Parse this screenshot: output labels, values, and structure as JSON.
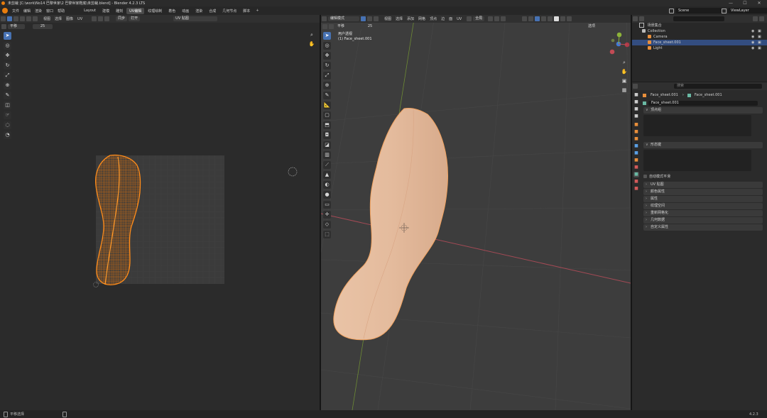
{
  "window": {
    "title": "未剪裁 [C:\\work\\No14 巴黎世家\\2 巴黎世家鞋底\\未剪裁.blend] - Blender 4.2.3 LTS",
    "minimize": "—",
    "maximize": "☐",
    "close": "✕"
  },
  "menubar": {
    "menus": [
      "文件",
      "编辑",
      "渲染",
      "窗口",
      "帮助"
    ],
    "workspaces": [
      "Layout",
      "建模",
      "雕刻",
      "UV编辑",
      "纹理绘制",
      "着色",
      "动画",
      "渲染",
      "合成",
      "几何节点",
      "脚本"
    ],
    "active_workspace": "UV编辑",
    "add_tab": "+",
    "scene_label": "Scene",
    "view_layer_label": "ViewLayer"
  },
  "uv_editor": {
    "header_menus": [
      "视图",
      "选择",
      "图像",
      "UV"
    ],
    "uv_map": "UV 贴图",
    "subheader_mode": "平移",
    "subheader_value": "25",
    "sync_label": "同步",
    "open_label": "打开",
    "tools": [
      "select-icon",
      "cursor-icon",
      "move-icon",
      "rotate-icon",
      "scale-icon",
      "transform-icon",
      "annotate-icon",
      "rip-icon",
      "grab-icon",
      "relax-icon",
      "pinch-icon"
    ]
  },
  "viewport": {
    "mode": "编辑模式",
    "header_menus": [
      "视图",
      "选择",
      "添加",
      "网格",
      "顶点",
      "边",
      "面",
      "UV"
    ],
    "transform_orientation": "全局",
    "subheader_mode": "平移",
    "subheader_value": "25",
    "options_label": "选项",
    "view_name": "用户透视",
    "object_name": "(1) Face_sheet.001",
    "tools": [
      "select-icon",
      "cursor-icon",
      "move-icon",
      "rotate-icon",
      "scale-icon",
      "transform-icon",
      "annotate-icon",
      "measure-icon",
      "add-cube-icon",
      "extrude-icon",
      "inset-icon",
      "bevel-icon",
      "loop-cut-icon",
      "knife-icon",
      "poly-build-icon",
      "spin-icon",
      "smooth-icon",
      "edge-slide-icon",
      "shrink-icon",
      "shear-icon",
      "rip-region-icon"
    ]
  },
  "outliner": {
    "search_placeholder": "",
    "scene_collection": "场景集合",
    "items": [
      {
        "label": "Collection",
        "indent": 1,
        "icon": "collection-icon",
        "selected": false
      },
      {
        "label": "Camera",
        "indent": 2,
        "icon": "camera-icon",
        "selected": false
      },
      {
        "label": "Face_sheet.001",
        "indent": 2,
        "icon": "mesh-icon",
        "selected": true
      },
      {
        "label": "Light",
        "indent": 2,
        "icon": "light-icon",
        "selected": false
      }
    ]
  },
  "properties": {
    "search_placeholder": "搜索",
    "breadcrumb_object": "Face_sheet.001",
    "breadcrumb_mesh": "Face_sheet.001",
    "mesh_name": "Face_sheet.001",
    "panel_vertex_groups": "顶点组",
    "panel_shape_keys": "形态键",
    "relative_label": "自动模式平滑",
    "panels": [
      "UV 贴图",
      "颜色属性",
      "属性",
      "纹理空间",
      "重新网格化",
      "几何数据",
      "自定义属性"
    ]
  },
  "statusbar": {
    "left": "平移选择",
    "right": "4.2.3"
  },
  "colors": {
    "accent": "#4772b3",
    "uv_selected": "#ff8c1a",
    "mesh_skin": "#e2b99b",
    "x_axis": "#b14a55",
    "y_axis": "#7f9a3a"
  }
}
